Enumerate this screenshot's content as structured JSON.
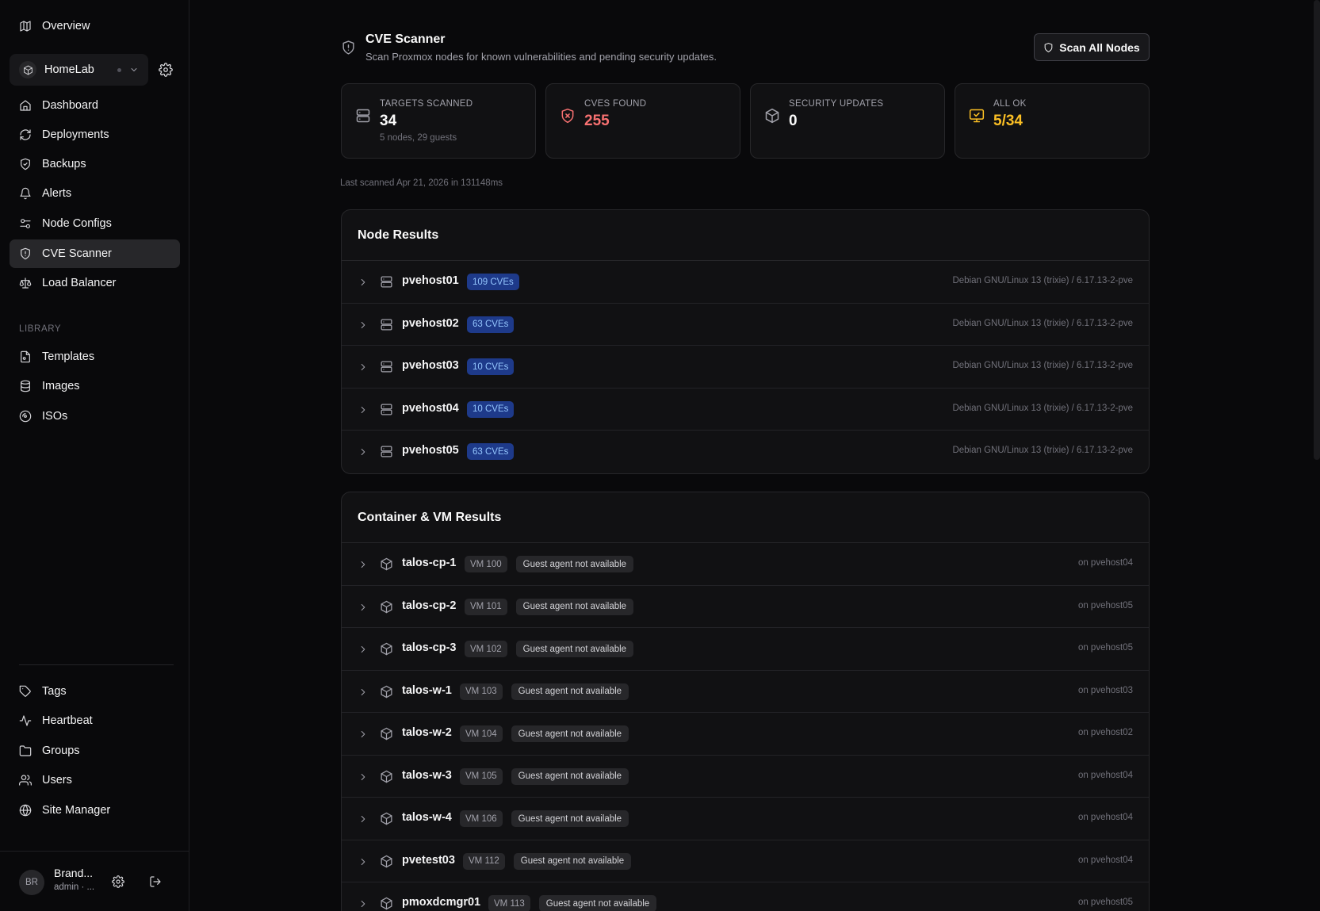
{
  "sidebar": {
    "overview": "Overview",
    "workspace": {
      "name": "HomeLab"
    },
    "nav": [
      {
        "label": "Dashboard",
        "icon": "home-icon"
      },
      {
        "label": "Deployments",
        "icon": "refresh-icon"
      },
      {
        "label": "Backups",
        "icon": "shield-check-icon"
      },
      {
        "label": "Alerts",
        "icon": "bell-icon"
      },
      {
        "label": "Node Configs",
        "icon": "sliders-icon"
      },
      {
        "label": "CVE Scanner",
        "icon": "shield-alert-icon",
        "active": true
      },
      {
        "label": "Load Balancer",
        "icon": "scale-icon"
      }
    ],
    "library_label": "LIBRARY",
    "library": [
      {
        "label": "Templates",
        "icon": "file-copy-icon"
      },
      {
        "label": "Images",
        "icon": "database-icon"
      },
      {
        "label": "ISOs",
        "icon": "disc-icon"
      }
    ],
    "bottom": [
      {
        "label": "Tags",
        "icon": "tag-icon"
      },
      {
        "label": "Heartbeat",
        "icon": "activity-icon"
      },
      {
        "label": "Groups",
        "icon": "folder-icon"
      },
      {
        "label": "Users",
        "icon": "users-icon"
      },
      {
        "label": "Site Manager",
        "icon": "globe-icon"
      }
    ],
    "user": {
      "initials": "BR",
      "name": "Brand...",
      "role": "admin · ..."
    }
  },
  "header": {
    "title": "CVE Scanner",
    "subtitle": "Scan Proxmox nodes for known vulnerabilities and pending security updates.",
    "scan_button": "Scan All Nodes"
  },
  "stats": [
    {
      "label": "TARGETS SCANNED",
      "value": "34",
      "sub": "5 nodes, 29 guests",
      "color": "#fafafa",
      "icon": "server-icon"
    },
    {
      "label": "CVES FOUND",
      "value": "255",
      "sub": "",
      "color": "#f87171",
      "icon": "shield-x-icon"
    },
    {
      "label": "SECURITY UPDATES",
      "value": "0",
      "sub": "",
      "color": "#fafafa",
      "icon": "package-icon"
    },
    {
      "label": "ALL OK",
      "value": "5/34",
      "sub": "",
      "color": "#fbbf24",
      "icon": "monitor-check-icon"
    }
  ],
  "last_scanned": "Last scanned Apr 21, 2026 in 131148ms",
  "node_results": {
    "title": "Node Results",
    "rows": [
      {
        "name": "pvehost01",
        "cves": "109 CVEs",
        "info": "Debian GNU/Linux 13 (trixie) / 6.17.13-2-pve"
      },
      {
        "name": "pvehost02",
        "cves": "63 CVEs",
        "info": "Debian GNU/Linux 13 (trixie) / 6.17.13-2-pve"
      },
      {
        "name": "pvehost03",
        "cves": "10 CVEs",
        "info": "Debian GNU/Linux 13 (trixie) / 6.17.13-2-pve"
      },
      {
        "name": "pvehost04",
        "cves": "10 CVEs",
        "info": "Debian GNU/Linux 13 (trixie) / 6.17.13-2-pve"
      },
      {
        "name": "pvehost05",
        "cves": "63 CVEs",
        "info": "Debian GNU/Linux 13 (trixie) / 6.17.13-2-pve"
      }
    ]
  },
  "guest_results": {
    "title": "Container & VM Results",
    "rows": [
      {
        "name": "talos-cp-1",
        "vm": "VM 100",
        "status": "Guest agent not available",
        "info": "on pvehost04"
      },
      {
        "name": "talos-cp-2",
        "vm": "VM 101",
        "status": "Guest agent not available",
        "info": "on pvehost05"
      },
      {
        "name": "talos-cp-3",
        "vm": "VM 102",
        "status": "Guest agent not available",
        "info": "on pvehost05"
      },
      {
        "name": "talos-w-1",
        "vm": "VM 103",
        "status": "Guest agent not available",
        "info": "on pvehost03"
      },
      {
        "name": "talos-w-2",
        "vm": "VM 104",
        "status": "Guest agent not available",
        "info": "on pvehost02"
      },
      {
        "name": "talos-w-3",
        "vm": "VM 105",
        "status": "Guest agent not available",
        "info": "on pvehost04"
      },
      {
        "name": "talos-w-4",
        "vm": "VM 106",
        "status": "Guest agent not available",
        "info": "on pvehost04"
      },
      {
        "name": "pvetest03",
        "vm": "VM 112",
        "status": "Guest agent not available",
        "info": "on pvehost04"
      },
      {
        "name": "pmoxdcmgr01",
        "vm": "VM 113",
        "status": "Guest agent not available",
        "info": "on pvehost05"
      }
    ]
  }
}
